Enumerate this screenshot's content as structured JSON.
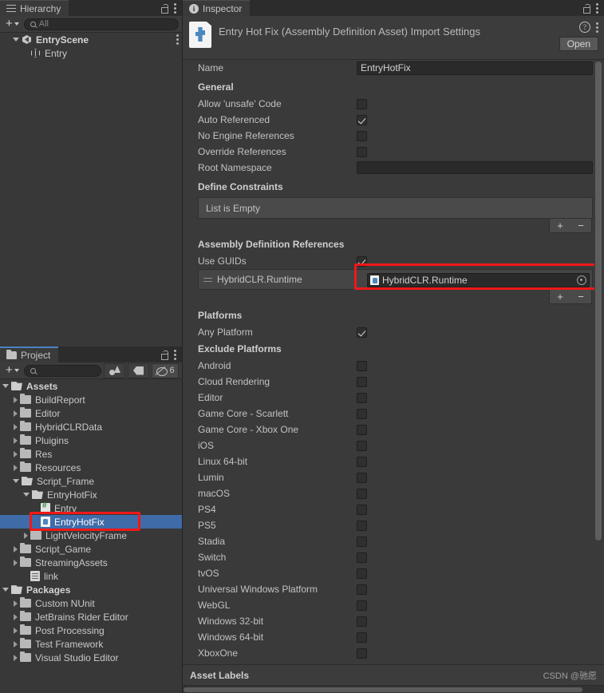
{
  "hierarchy": {
    "tab_label": "Hierarchy",
    "add_label": "+",
    "search_placeholder": "All",
    "items": [
      {
        "label": "EntryScene",
        "indent": 1,
        "type": "scene",
        "expanded": true,
        "bold": true,
        "menu": true
      },
      {
        "label": "Entry",
        "indent": 2,
        "type": "cube",
        "expanded": null,
        "bold": false,
        "menu": false
      }
    ]
  },
  "project": {
    "tab_label": "Project",
    "add_label": "+",
    "search_placeholder": "",
    "filter_count": "6",
    "items": [
      {
        "label": "Assets",
        "indent": 0,
        "type": "folder",
        "expanded": true,
        "bold": true,
        "selected": false
      },
      {
        "label": "BuildReport",
        "indent": 1,
        "type": "folder",
        "expanded": false,
        "bold": false,
        "selected": false
      },
      {
        "label": "Editor",
        "indent": 1,
        "type": "folder",
        "expanded": false,
        "bold": false,
        "selected": false
      },
      {
        "label": "HybridCLRData",
        "indent": 1,
        "type": "folder",
        "expanded": false,
        "bold": false,
        "selected": false
      },
      {
        "label": "Pluigins",
        "indent": 1,
        "type": "folder",
        "expanded": false,
        "bold": false,
        "selected": false
      },
      {
        "label": "Res",
        "indent": 1,
        "type": "folder",
        "expanded": false,
        "bold": false,
        "selected": false
      },
      {
        "label": "Resources",
        "indent": 1,
        "type": "folder",
        "expanded": false,
        "bold": false,
        "selected": false
      },
      {
        "label": "Script_Frame",
        "indent": 1,
        "type": "folder",
        "expanded": true,
        "bold": false,
        "selected": false
      },
      {
        "label": "EntryHotFix",
        "indent": 2,
        "type": "folder",
        "expanded": true,
        "bold": false,
        "selected": false
      },
      {
        "label": "Entry",
        "indent": 3,
        "type": "cs",
        "expanded": null,
        "bold": false,
        "selected": false
      },
      {
        "label": "EntryHotFix",
        "indent": 3,
        "type": "asmdef",
        "expanded": null,
        "bold": false,
        "selected": true
      },
      {
        "label": "LightVelocityFrame",
        "indent": 2,
        "type": "folder",
        "expanded": false,
        "bold": false,
        "selected": false
      },
      {
        "label": "Script_Game",
        "indent": 1,
        "type": "folder",
        "expanded": false,
        "bold": false,
        "selected": false
      },
      {
        "label": "StreamingAssets",
        "indent": 1,
        "type": "folder",
        "expanded": false,
        "bold": false,
        "selected": false
      },
      {
        "label": "link",
        "indent": 2,
        "type": "text",
        "expanded": null,
        "bold": false,
        "selected": false
      },
      {
        "label": "Packages",
        "indent": 0,
        "type": "folder",
        "expanded": true,
        "bold": true,
        "selected": false
      },
      {
        "label": "Custom NUnit",
        "indent": 1,
        "type": "folder",
        "expanded": false,
        "bold": false,
        "selected": false
      },
      {
        "label": "JetBrains Rider Editor",
        "indent": 1,
        "type": "folder",
        "expanded": false,
        "bold": false,
        "selected": false
      },
      {
        "label": "Post Processing",
        "indent": 1,
        "type": "folder",
        "expanded": false,
        "bold": false,
        "selected": false
      },
      {
        "label": "Test Framework",
        "indent": 1,
        "type": "folder",
        "expanded": false,
        "bold": false,
        "selected": false
      },
      {
        "label": "Visual Studio Editor",
        "indent": 1,
        "type": "folder",
        "expanded": false,
        "bold": false,
        "selected": false
      }
    ]
  },
  "inspector": {
    "tab_label": "Inspector",
    "asset_title": "Entry Hot Fix (Assembly Definition Asset) Import Settings",
    "open_button": "Open",
    "name_label": "Name",
    "name_value": "EntryHotFix",
    "general_header": "General",
    "general": [
      {
        "label": "Allow 'unsafe' Code",
        "checked": false
      },
      {
        "label": "Auto Referenced",
        "checked": true
      },
      {
        "label": "No Engine References",
        "checked": false
      },
      {
        "label": "Override References",
        "checked": false
      }
    ],
    "root_namespace_label": "Root Namespace",
    "root_namespace_value": "",
    "define_constraints_header": "Define Constraints",
    "define_constraints_empty": "List is Empty",
    "add_label": "+",
    "remove_label": "−",
    "asmref_header": "Assembly Definition References",
    "use_guids_label": "Use GUIDs",
    "use_guids_checked": true,
    "asmref_row_label": "HybridCLR.Runtime",
    "asmref_object_value": "HybridCLR.Runtime",
    "platforms_header": "Platforms",
    "any_platform_label": "Any Platform",
    "any_platform_checked": true,
    "exclude_platforms_header": "Exclude Platforms",
    "platforms": [
      {
        "label": "Android",
        "checked": false
      },
      {
        "label": "Cloud Rendering",
        "checked": false
      },
      {
        "label": "Editor",
        "checked": false
      },
      {
        "label": "Game Core - Scarlett",
        "checked": false
      },
      {
        "label": "Game Core - Xbox One",
        "checked": false
      },
      {
        "label": "iOS",
        "checked": false
      },
      {
        "label": "Linux 64-bit",
        "checked": false
      },
      {
        "label": "Lumin",
        "checked": false
      },
      {
        "label": "macOS",
        "checked": false
      },
      {
        "label": "PS4",
        "checked": false
      },
      {
        "label": "PS5",
        "checked": false
      },
      {
        "label": "Stadia",
        "checked": false
      },
      {
        "label": "Switch",
        "checked": false
      },
      {
        "label": "tvOS",
        "checked": false
      },
      {
        "label": "Universal Windows Platform",
        "checked": false
      },
      {
        "label": "WebGL",
        "checked": false
      },
      {
        "label": "Windows 32-bit",
        "checked": false
      },
      {
        "label": "Windows 64-bit",
        "checked": false
      },
      {
        "label": "XboxOne",
        "checked": false
      }
    ],
    "asset_labels_header": "Asset Labels",
    "watermark": "CSDN @驰愿"
  },
  "colors": {
    "panel_bg": "#383838",
    "header_bg": "#3c3c3c",
    "selection_blue": "#3f6ba8",
    "annotation_red": "#f01818",
    "accent_blue": "#4b7fc4"
  }
}
